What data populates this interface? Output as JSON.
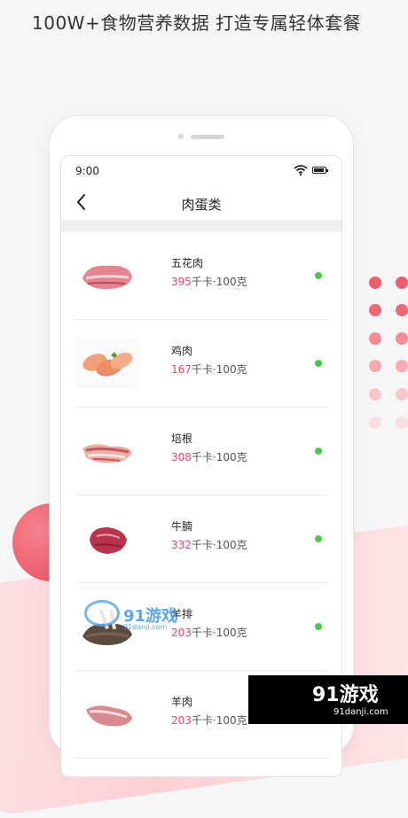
{
  "headline": "100W+食物营养数据 打造专属轻体套餐",
  "status_bar": {
    "time": "9:00"
  },
  "nav": {
    "title": "肉蛋类"
  },
  "unit_text": "千卡·100克",
  "foods": [
    {
      "name": "五花肉",
      "calories": "395",
      "icon": "pork-belly-icon"
    },
    {
      "name": "鸡肉",
      "calories": "167",
      "icon": "chicken-icon"
    },
    {
      "name": "培根",
      "calories": "308",
      "icon": "bacon-icon"
    },
    {
      "name": "牛腩",
      "calories": "332",
      "icon": "beef-brisket-icon"
    },
    {
      "name": "羊排",
      "calories": "203",
      "icon": "lamb-chop-icon"
    },
    {
      "name": "羊肉",
      "calories": "203",
      "icon": "lamb-icon"
    }
  ],
  "colors": {
    "accent": "#f0466a",
    "status_green": "#4cc74c"
  },
  "watermark": {
    "text": "91游戏",
    "site": "91danji.com"
  }
}
